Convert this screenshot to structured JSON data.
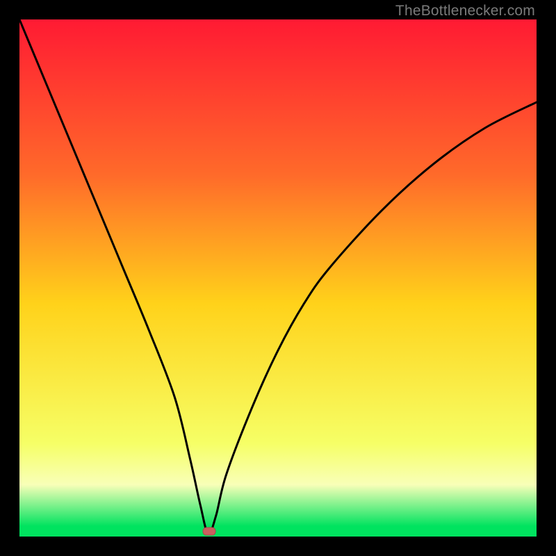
{
  "watermark": "TheBottlenecker.com",
  "colors": {
    "frame": "#000000",
    "gradient_top": "#ff1a33",
    "gradient_upper": "#ff6a2a",
    "gradient_mid": "#ffd21a",
    "gradient_lower": "#f6ff66",
    "gradient_pale": "#f8ffb8",
    "gradient_green": "#00e35f",
    "curve": "#000000",
    "marker_fill": "#c9605f",
    "marker_stroke": "#a84d4c"
  },
  "chart_data": {
    "type": "line",
    "title": "",
    "xlabel": "",
    "ylabel": "",
    "xlim": [
      0,
      100
    ],
    "ylim": [
      0,
      100
    ],
    "notes": "Bottleneck V-curve over a red→green vertical gradient. No axis ticks or numeric labels visible; values below are positional estimates (percent of plot width/height).",
    "series": [
      {
        "name": "bottleneck-curve",
        "x": [
          0,
          5,
          10,
          15,
          20,
          25,
          30,
          33,
          35,
          36.5,
          38,
          40,
          45,
          50,
          55,
          60,
          70,
          80,
          90,
          100
        ],
        "y": [
          100,
          88,
          76,
          64,
          52,
          40,
          27,
          15,
          6,
          0.5,
          4,
          12,
          25,
          36,
          45,
          52,
          63,
          72,
          79,
          84
        ]
      }
    ],
    "marker": {
      "x": 36.7,
      "y": 1.0,
      "shape": "rounded-rect"
    },
    "gradient_stops_pct": [
      {
        "pct": 0,
        "color": "gradient_top"
      },
      {
        "pct": 30,
        "color": "gradient_upper"
      },
      {
        "pct": 55,
        "color": "gradient_mid"
      },
      {
        "pct": 82,
        "color": "gradient_lower"
      },
      {
        "pct": 90,
        "color": "gradient_pale"
      },
      {
        "pct": 98,
        "color": "gradient_green"
      },
      {
        "pct": 100,
        "color": "gradient_green"
      }
    ]
  }
}
